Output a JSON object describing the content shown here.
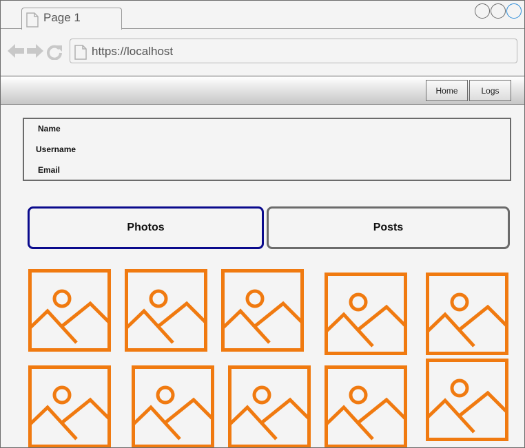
{
  "browser": {
    "tab_title": "Page 1",
    "url": "https://localhost"
  },
  "nav": {
    "home_label": "Home",
    "logs_label": "Logs"
  },
  "profile": {
    "name_label": "Name",
    "username_label": "Username",
    "email_label": "Email"
  },
  "tabs": {
    "photos_label": "Photos",
    "posts_label": "Posts"
  },
  "photos": {
    "icon": "image-placeholder-icon",
    "count": 10
  },
  "colors": {
    "accent_orange": "#f07a10",
    "selected_tab_border": "#0a0a8c",
    "window_control_active": "#2a8bd8"
  }
}
